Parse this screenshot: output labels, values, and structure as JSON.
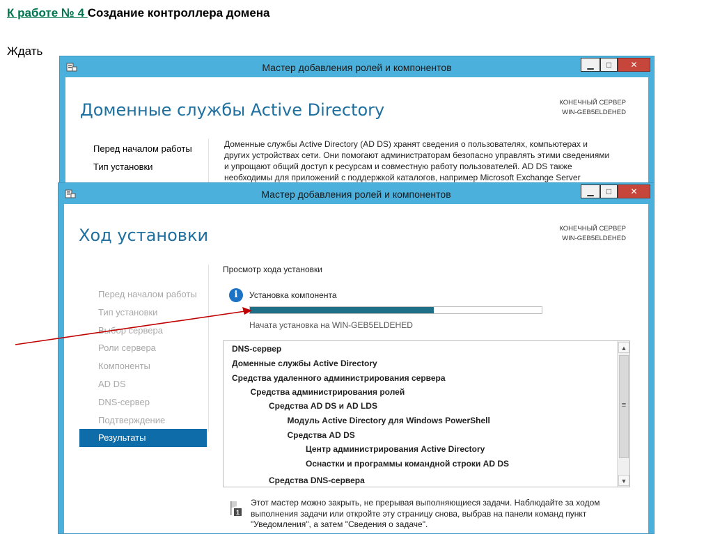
{
  "slide": {
    "title_link": "К работе № 4 ",
    "title_rest": "Создание контроллера домена",
    "subtitle": "Ждать"
  },
  "window_back": {
    "title": "Мастер добавления ролей и компонентов",
    "heading": "Доменные службы Active Directory",
    "server_label": "КОНЕЧНЫЙ СЕРВЕР",
    "server_name": "WIN-GEB5ELDEHED",
    "nav": [
      "Перед началом работы",
      "Тип установки"
    ],
    "description": "Доменные службы Active Directory (AD DS) хранят сведения о пользователях, компьютерах и других устройствах сети.  Они помогают администраторам безопасно управлять этими сведениями и упрощают общий доступ к ресурсам и совместную работу пользователей.  AD DS также необходимы для приложений с поддержкой каталогов, например Microsoft Exchange Server"
  },
  "window_front": {
    "title": "Мастер добавления ролей и компонентов",
    "heading": "Ход установки",
    "server_label": "КОНЕЧНЫЙ СЕРВЕР",
    "server_name": "WIN-GEB5ELDEHED",
    "nav": [
      {
        "label": "Перед началом работы",
        "active": false
      },
      {
        "label": "Тип установки",
        "active": false
      },
      {
        "label": "Выбор сервера",
        "active": false
      },
      {
        "label": "Роли сервера",
        "active": false
      },
      {
        "label": "Компоненты",
        "active": false
      },
      {
        "label": "AD DS",
        "active": false
      },
      {
        "label": "DNS-сервер",
        "active": false
      },
      {
        "label": "Подтверждение",
        "active": false
      },
      {
        "label": "Результаты",
        "active": true
      }
    ],
    "progress_header": "Просмотр хода установки",
    "status_text": "Установка компонента",
    "progress_fraction": 0.63,
    "started_text": "Начата установка на WIN-GEB5ELDEHED",
    "results": [
      {
        "label": "DNS-сервер",
        "level": 0
      },
      {
        "label": "Доменные службы Active Directory",
        "level": 0
      },
      {
        "label": "Средства удаленного администрирования сервера",
        "level": 0
      },
      {
        "label": "Средства администрирования ролей",
        "level": 1
      },
      {
        "label": "Средства AD DS и AD LDS",
        "level": 2
      },
      {
        "label": "Модуль Active Directory для Windows PowerShell",
        "level": 3
      },
      {
        "label": "Средства AD DS",
        "level": 3
      },
      {
        "label": "Центр администрирования Active Directory",
        "level": 4
      },
      {
        "label": "Оснастки и программы командной строки AD DS",
        "level": 4
      },
      {
        "label": "Средства DNS-сервера",
        "level": 2
      }
    ],
    "note_text": "Этот мастер можно закрыть, не прерывая выполняющиеся задачи. Наблюдайте за ходом выполнения задачи или откройте эту страницу снова, выбрав на панели команд пункт \"Уведомления\", а затем \"Сведения о задаче\".",
    "note_badge": "1"
  },
  "colors": {
    "window_frame": "#4cb0dc",
    "heading": "#1f6f9f",
    "nav_active": "#0e6da8",
    "progress": "#1e6f87",
    "arrow": "#c00000",
    "link": "#00754f"
  }
}
